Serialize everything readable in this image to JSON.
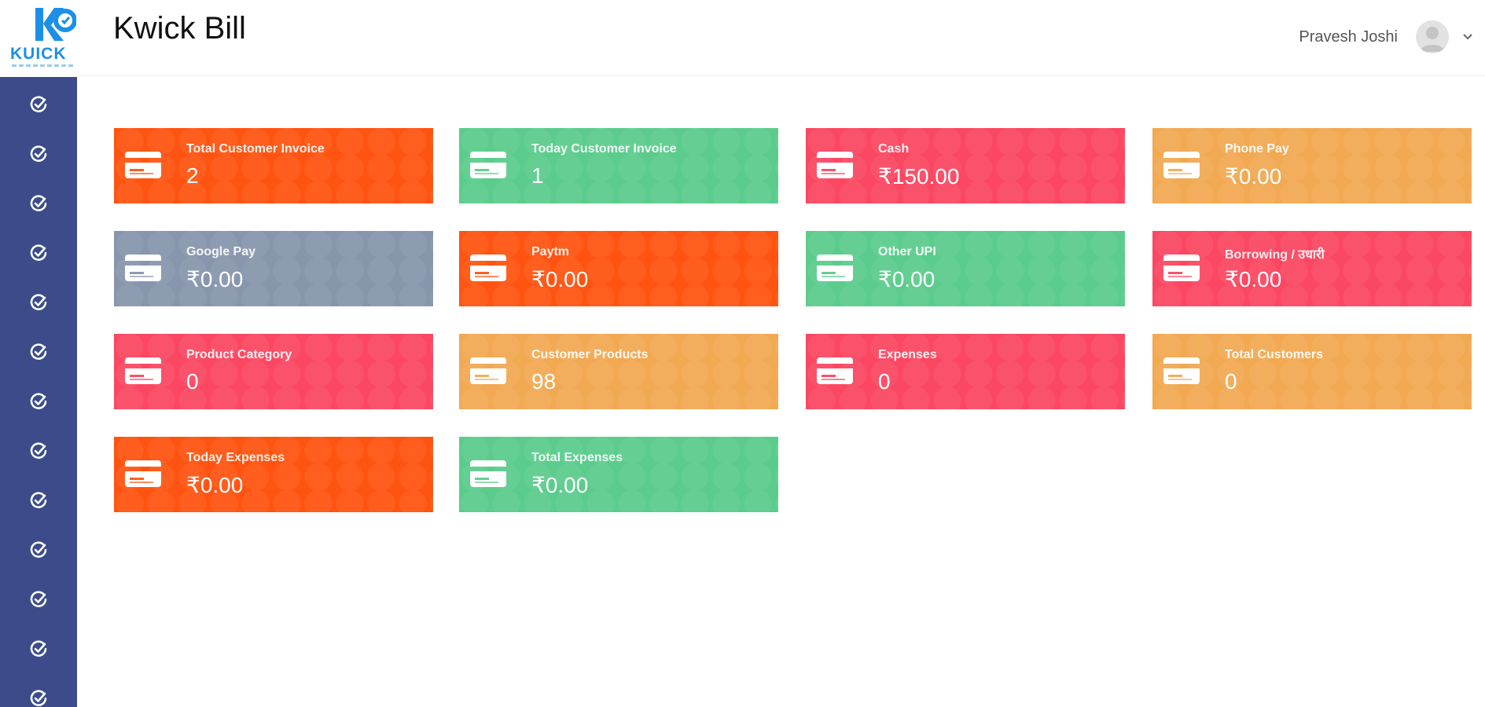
{
  "app": {
    "title": "Kwick Bill",
    "logo_text": "KUICK"
  },
  "user": {
    "name": "Pravesh Joshi"
  },
  "colors": {
    "sidebar": "#3c4c8a",
    "orange": "#ff5411",
    "green": "#5bcc8c",
    "red": "#fb4762",
    "amber": "#f1a952",
    "slate": "#8796ad",
    "brand": "#1c8fe6"
  },
  "sidebar": {
    "items": [
      {
        "icon": "check-circle-icon"
      },
      {
        "icon": "check-circle-icon"
      },
      {
        "icon": "check-circle-icon"
      },
      {
        "icon": "check-circle-icon"
      },
      {
        "icon": "check-circle-icon"
      },
      {
        "icon": "check-circle-icon"
      },
      {
        "icon": "check-circle-icon"
      },
      {
        "icon": "check-circle-icon"
      },
      {
        "icon": "check-circle-icon"
      },
      {
        "icon": "check-circle-icon"
      },
      {
        "icon": "check-circle-icon"
      },
      {
        "icon": "check-circle-icon"
      },
      {
        "icon": "check-circle-icon"
      }
    ]
  },
  "cards": [
    {
      "label": "Total Customer Invoice",
      "value": "2",
      "color": "#ff5411",
      "icon": "credit-card-icon"
    },
    {
      "label": "Today Customer Invoice",
      "value": "1",
      "color": "#5bcc8c",
      "icon": "credit-card-icon"
    },
    {
      "label": "Cash",
      "value": "₹150.00",
      "color": "#fb4762",
      "icon": "credit-card-icon"
    },
    {
      "label": "Phone Pay",
      "value": "₹0.00",
      "color": "#f1a952",
      "icon": "credit-card-icon"
    },
    {
      "label": "Google Pay",
      "value": "₹0.00",
      "color": "#8796ad",
      "icon": "credit-card-icon"
    },
    {
      "label": "Paytm",
      "value": "₹0.00",
      "color": "#ff5411",
      "icon": "credit-card-icon"
    },
    {
      "label": "Other UPI",
      "value": "₹0.00",
      "color": "#5bcc8c",
      "icon": "credit-card-icon"
    },
    {
      "label": "Borrowing / उधारी",
      "value": "₹0.00",
      "color": "#fb4762",
      "icon": "credit-card-icon"
    },
    {
      "label": "Product Category",
      "value": "0",
      "color": "#fb4762",
      "icon": "credit-card-icon"
    },
    {
      "label": "Customer Products",
      "value": "98",
      "color": "#f1a952",
      "icon": "credit-card-icon"
    },
    {
      "label": "Expenses",
      "value": "0",
      "color": "#fb4762",
      "icon": "credit-card-icon"
    },
    {
      "label": "Total Customers",
      "value": "0",
      "color": "#f1a952",
      "icon": "credit-card-icon"
    },
    {
      "label": "Today Expenses",
      "value": "₹0.00",
      "color": "#ff5411",
      "icon": "credit-card-icon"
    },
    {
      "label": "Total Expenses",
      "value": "₹0.00",
      "color": "#5bcc8c",
      "icon": "credit-card-icon"
    }
  ]
}
